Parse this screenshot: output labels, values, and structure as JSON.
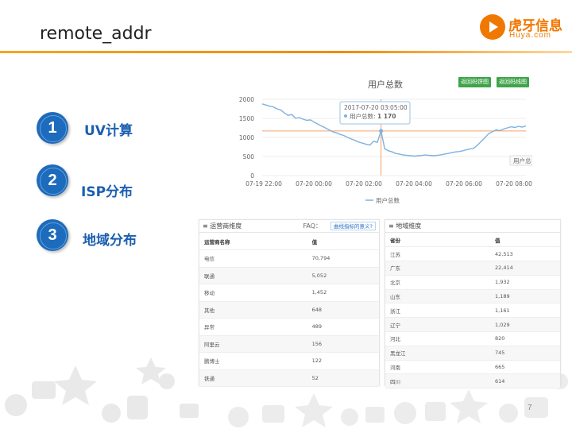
{
  "slide": {
    "title": "remote_addr",
    "page_number": "7"
  },
  "logo": {
    "cn": "虎牙信息",
    "en": "Huya.com"
  },
  "items": [
    {
      "num": "1",
      "label": "UV计算"
    },
    {
      "num": "2",
      "label": "ISP分布"
    },
    {
      "num": "3",
      "label": "地域分布"
    }
  ],
  "chart": {
    "title": "用户总数",
    "buttons": [
      "返回码饼图",
      "返回码线图"
    ],
    "legend": "用户总数",
    "tooltip_time": "2017-07-20 03:05:00",
    "tooltip_label": "用户总数:",
    "tooltip_value": "1 170",
    "side_label": "用户总",
    "colors": {
      "line": "#7fb2df",
      "threshold": "#f4a06b",
      "crosshair": "#f4a06b"
    }
  },
  "chart_data": {
    "type": "line",
    "title": "用户总数",
    "x_ticks": [
      "07-19 22:00",
      "07-20 00:00",
      "07-20 02:00",
      "07-20 04:00",
      "07-20 06:00",
      "07-20 08:00"
    ],
    "y_ticks": [
      0,
      500,
      1000,
      1500,
      2000
    ],
    "ylim": [
      0,
      2000
    ],
    "threshold": 1170,
    "series": [
      {
        "name": "用户总数",
        "values": [
          1880,
          1850,
          1820,
          1800,
          1750,
          1720,
          1640,
          1580,
          1600,
          1500,
          1520,
          1480,
          1450,
          1460,
          1400,
          1350,
          1300,
          1250,
          1200,
          1150,
          1120,
          1080,
          1050,
          1000,
          960,
          920,
          880,
          850,
          820,
          800,
          900,
          870,
          1170,
          700,
          650,
          620,
          580,
          560,
          540,
          530,
          520,
          510,
          520,
          530,
          540,
          530,
          520,
          530,
          540,
          560,
          580,
          600,
          620,
          630,
          650,
          680,
          700,
          720,
          800,
          900,
          1000,
          1100,
          1150,
          1200,
          1180,
          1220,
          1250,
          1280,
          1260,
          1290,
          1270,
          1300
        ]
      }
    ]
  },
  "isp_table": {
    "title": "运营商维度",
    "faq": "FAQ：",
    "faq_link": "曲线指标的意义?",
    "headers": [
      "运营商名称",
      "值"
    ],
    "rows": [
      [
        "电信",
        "70,794"
      ],
      [
        "联通",
        "5,052"
      ],
      [
        "移动",
        "1,452"
      ],
      [
        "其他",
        "648"
      ],
      [
        "异常",
        "489"
      ],
      [
        "阿里云",
        "156"
      ],
      [
        "鹏博士",
        "122"
      ],
      [
        "铁通",
        "52"
      ]
    ]
  },
  "region_table": {
    "title": "地域维度",
    "headers": [
      "省份",
      "值"
    ],
    "rows": [
      [
        "江苏",
        "42,513"
      ],
      [
        "广东",
        "22,414"
      ],
      [
        "北京",
        "1,932"
      ],
      [
        "山东",
        "1,189"
      ],
      [
        "浙江",
        "1,161"
      ],
      [
        "辽宁",
        "1,029"
      ],
      [
        "河北",
        "820"
      ],
      [
        "黑龙江",
        "745"
      ],
      [
        "河南",
        "665"
      ],
      [
        "四川",
        "614"
      ]
    ]
  }
}
